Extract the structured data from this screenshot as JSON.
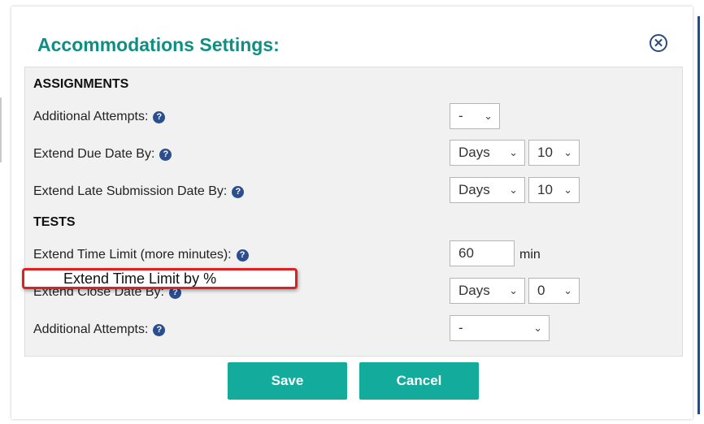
{
  "dialog": {
    "title": "Accommodations Settings:",
    "close_icon": "close-icon",
    "close_glyph": "✕"
  },
  "assignments": {
    "heading": "ASSIGNMENTS",
    "additional_attempts": {
      "label": "Additional Attempts:",
      "value": "-"
    },
    "extend_due_date": {
      "label": "Extend Due Date By:",
      "unit": "Days",
      "amount": "10"
    },
    "extend_late_submission": {
      "label": "Extend Late Submission Date By:",
      "unit": "Days",
      "amount": "10"
    }
  },
  "tests": {
    "heading": "TESTS",
    "extend_time_limit": {
      "label": "Extend Time Limit (more minutes):",
      "value": "60",
      "unit": "min"
    },
    "extend_close_date": {
      "label": "Extend Close Date By:",
      "unit": "Days",
      "amount": "0"
    },
    "additional_attempts": {
      "label": "Additional Attempts:",
      "value": "-"
    }
  },
  "annotation": {
    "text": "Extend Time Limit by %"
  },
  "help_glyph": "?",
  "chevron_glyph": "⌄",
  "buttons": {
    "save": "Save",
    "cancel": "Cancel"
  },
  "colors": {
    "title": "#0f8f82",
    "button": "#12ab9c",
    "help_icon": "#2b4f8e",
    "annotation_border": "#e02020"
  }
}
